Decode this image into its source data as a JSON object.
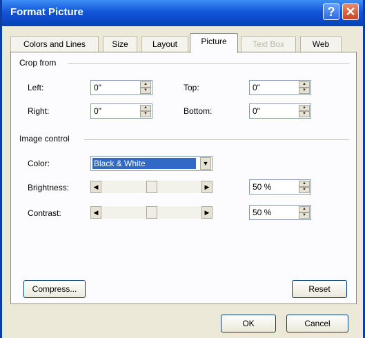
{
  "window": {
    "title": "Format Picture",
    "help_glyph": "?",
    "close_glyph": "✕"
  },
  "tabs": [
    {
      "label": "Colors and Lines",
      "state": "normal"
    },
    {
      "label": "Size",
      "state": "normal"
    },
    {
      "label": "Layout",
      "state": "normal"
    },
    {
      "label": "Picture",
      "state": "active"
    },
    {
      "label": "Text Box",
      "state": "disabled"
    },
    {
      "label": "Web",
      "state": "normal"
    }
  ],
  "crop": {
    "heading": "Crop from",
    "left_label": "Left:",
    "left_value": "0\"",
    "top_label": "Top:",
    "top_value": "0\"",
    "right_label": "Right:",
    "right_value": "0\"",
    "bottom_label": "Bottom:",
    "bottom_value": "0\""
  },
  "image_control": {
    "heading": "Image control",
    "color_label": "Color:",
    "color_value": "Black & White",
    "brightness_label": "Brightness:",
    "brightness_value": "50 %",
    "brightness_level": 0.5,
    "contrast_label": "Contrast:",
    "contrast_value": "50 %",
    "contrast_level": 0.5
  },
  "buttons": {
    "compress": "Compress...",
    "reset": "Reset",
    "ok": "OK",
    "cancel": "Cancel"
  },
  "colors": {
    "titlebar": "#1256d8",
    "selection": "#316ac5",
    "face": "#ece9d8"
  }
}
